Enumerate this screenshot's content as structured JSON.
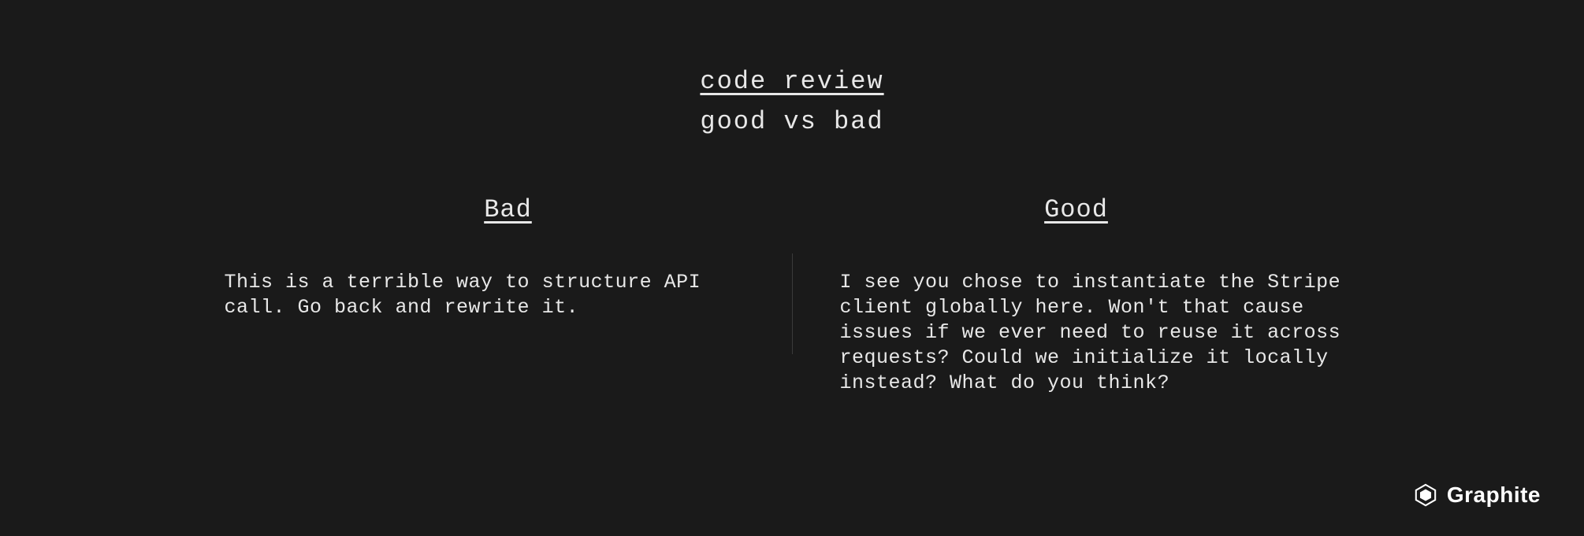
{
  "header": {
    "title": "code review",
    "subtitle": "good vs bad"
  },
  "columns": {
    "bad": {
      "heading": "Bad",
      "body": "This is a terrible way to structure API call. Go back and rewrite it."
    },
    "good": {
      "heading": "Good",
      "body": "I see you chose to instantiate the Stripe client globally here. Won't that cause issues if we ever need to reuse it across requests? Could we initialize it locally instead? What do you think?"
    }
  },
  "brand": {
    "name": "Graphite"
  }
}
